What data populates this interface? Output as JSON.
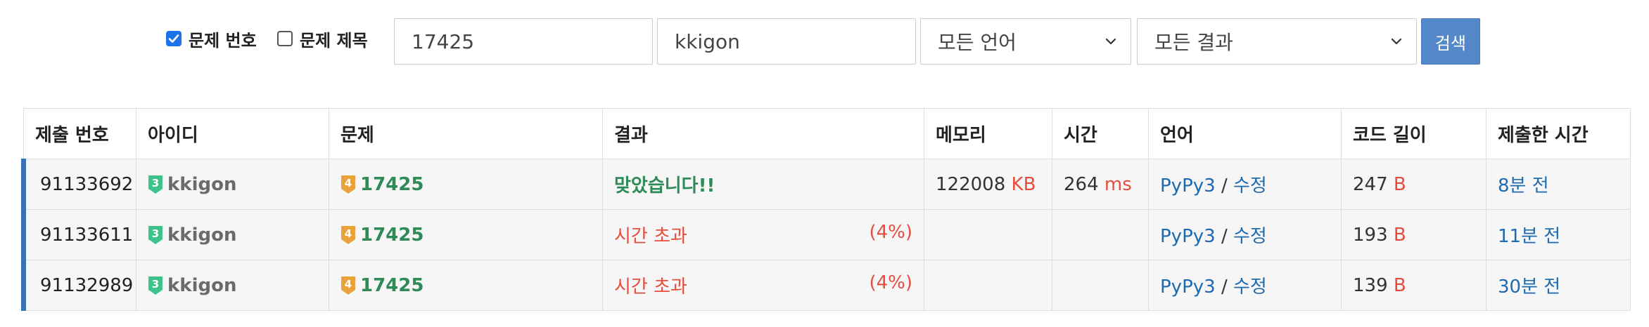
{
  "filters": {
    "problem_number_checkbox": {
      "label": "문제 번호",
      "checked": true
    },
    "problem_title_checkbox": {
      "label": "문제 제목",
      "checked": false
    },
    "problem_input": "17425",
    "user_input": "kkigon",
    "language_select": "모든 언어",
    "result_select": "모든 결과",
    "search_label": "검색"
  },
  "table": {
    "headers": [
      "제출 번호",
      "아이디",
      "문제",
      "결과",
      "메모리",
      "시간",
      "언어",
      "코드 길이",
      "제출한 시간"
    ],
    "rows": [
      {
        "submission_id": "91133692",
        "user_tier": "3",
        "user": "kkigon",
        "problem_tier": "4",
        "problem": "17425",
        "result": "맞았습니다!!",
        "result_percent": "",
        "memory": "122008",
        "memory_unit": "KB",
        "time": "264",
        "time_unit": "ms",
        "language": "PyPy3",
        "separator": " / ",
        "edit": "수정",
        "code_length": "247",
        "code_unit": "B",
        "submitted": "8분 전"
      },
      {
        "submission_id": "91133611",
        "user_tier": "3",
        "user": "kkigon",
        "problem_tier": "4",
        "problem": "17425",
        "result": "시간 초과",
        "result_percent": "(4%)",
        "memory": "",
        "memory_unit": "",
        "time": "",
        "time_unit": "",
        "language": "PyPy3",
        "separator": " / ",
        "edit": "수정",
        "code_length": "193",
        "code_unit": "B",
        "submitted": "11분 전"
      },
      {
        "submission_id": "91132989",
        "user_tier": "3",
        "user": "kkigon",
        "problem_tier": "4",
        "problem": "17425",
        "result": "시간 초과",
        "result_percent": "(4%)",
        "memory": "",
        "memory_unit": "",
        "time": "",
        "time_unit": "",
        "language": "PyPy3",
        "separator": " / ",
        "edit": "수정",
        "code_length": "139",
        "code_unit": "B",
        "submitted": "30분 전"
      }
    ]
  },
  "colors": {
    "accent": "#5588c8",
    "accepted": "#2e8b57",
    "error": "#e74c3c",
    "link": "#1e6ab0",
    "user_tier_badge": "#3cc28a",
    "problem_tier_badge": "#e8a33a",
    "row_marker": "#3a72b8"
  },
  "icons": {
    "select_arrow": "chevron-down-icon",
    "user_tier": "tier-badge-icon",
    "problem_tier": "tier-badge-icon",
    "checked": "check-icon"
  }
}
